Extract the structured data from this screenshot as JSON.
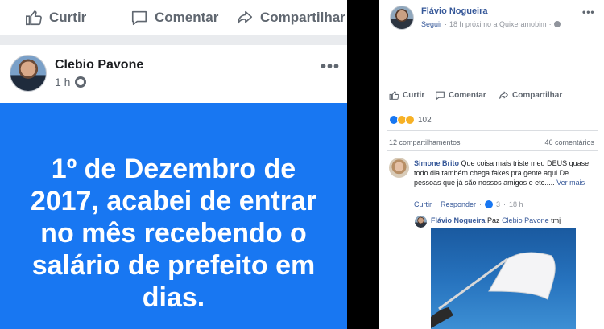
{
  "left": {
    "actions": {
      "like": "Curtir",
      "comment": "Comentar",
      "share": "Compartilhar"
    },
    "post": {
      "author": "Clebio Pavone",
      "time": "1 h",
      "visibility_icon": "globe-icon",
      "more_label": "•••",
      "text": "1º de Dezembro de 2017, acabei de entrar no mês recebendo o salário de prefeito em dias.",
      "background_color": "#1877f2"
    }
  },
  "right": {
    "header": {
      "author": "Flávio Nogueira",
      "follow": "Seguir",
      "sep1": "·",
      "time_location": "18 h próximo a Quixeramobim",
      "sep2": "·",
      "more_label": "•••"
    },
    "actions": {
      "like": "Curtir",
      "comment": "Comentar",
      "share": "Compartilhar"
    },
    "reactions": {
      "count": "102"
    },
    "stats": {
      "shares": "12 compartilhamentos",
      "comments": "46 comentários"
    },
    "comment1": {
      "author": "Simone Brito",
      "text": "Que coisa mais triste meu DEUS quase todo dia também chega fakes pra gente aqui De pessoas que já são nossos amigos e etc.....",
      "more": "Ver mais",
      "like": "Curtir",
      "sep1": "·",
      "reply": "Responder",
      "sep2": "·",
      "reaction_count": "3",
      "sep3": "·",
      "time": "18 h"
    },
    "reply1": {
      "author": "Flávio Nogueira",
      "text_prefix": "Paz",
      "mention": "Clebio Pavone",
      "text_suffix": "tmj"
    }
  }
}
